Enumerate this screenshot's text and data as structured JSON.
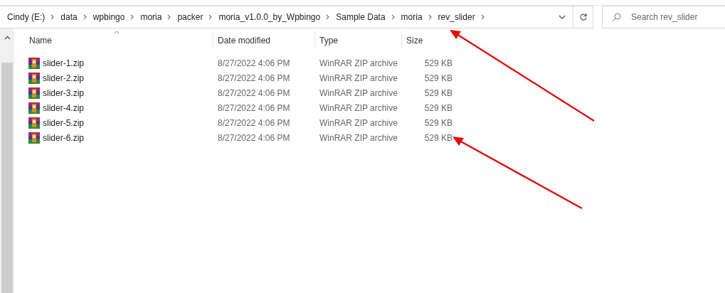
{
  "breadcrumb": [
    "Cindy (E:)",
    "data",
    "wpbingo",
    "moria",
    "packer",
    "moria_v1.0.0_by_Wpbingo",
    "Sample Data",
    "moria",
    "rev_slider"
  ],
  "search": {
    "placeholder": "Search rev_slider"
  },
  "columns": [
    "Name",
    "Date modified",
    "Type",
    "Size"
  ],
  "rows": [
    {
      "name": "slider-1.zip",
      "date": "8/27/2022 4:06 PM",
      "type": "WinRAR ZIP archive",
      "size": "529 KB"
    },
    {
      "name": "slider-2.zip",
      "date": "8/27/2022 4:06 PM",
      "type": "WinRAR ZIP archive",
      "size": "529 KB"
    },
    {
      "name": "slider-3.zip",
      "date": "8/27/2022 4:06 PM",
      "type": "WinRAR ZIP archive",
      "size": "529 KB"
    },
    {
      "name": "slider-4.zip",
      "date": "8/27/2022 4:06 PM",
      "type": "WinRAR ZIP archive",
      "size": "529 KB"
    },
    {
      "name": "slider-5.zip",
      "date": "8/27/2022 4:06 PM",
      "type": "WinRAR ZIP archive",
      "size": "529 KB"
    },
    {
      "name": "slider-6.zip",
      "date": "8/27/2022 4:06 PM",
      "type": "WinRAR ZIP archive",
      "size": "529 KB"
    }
  ]
}
